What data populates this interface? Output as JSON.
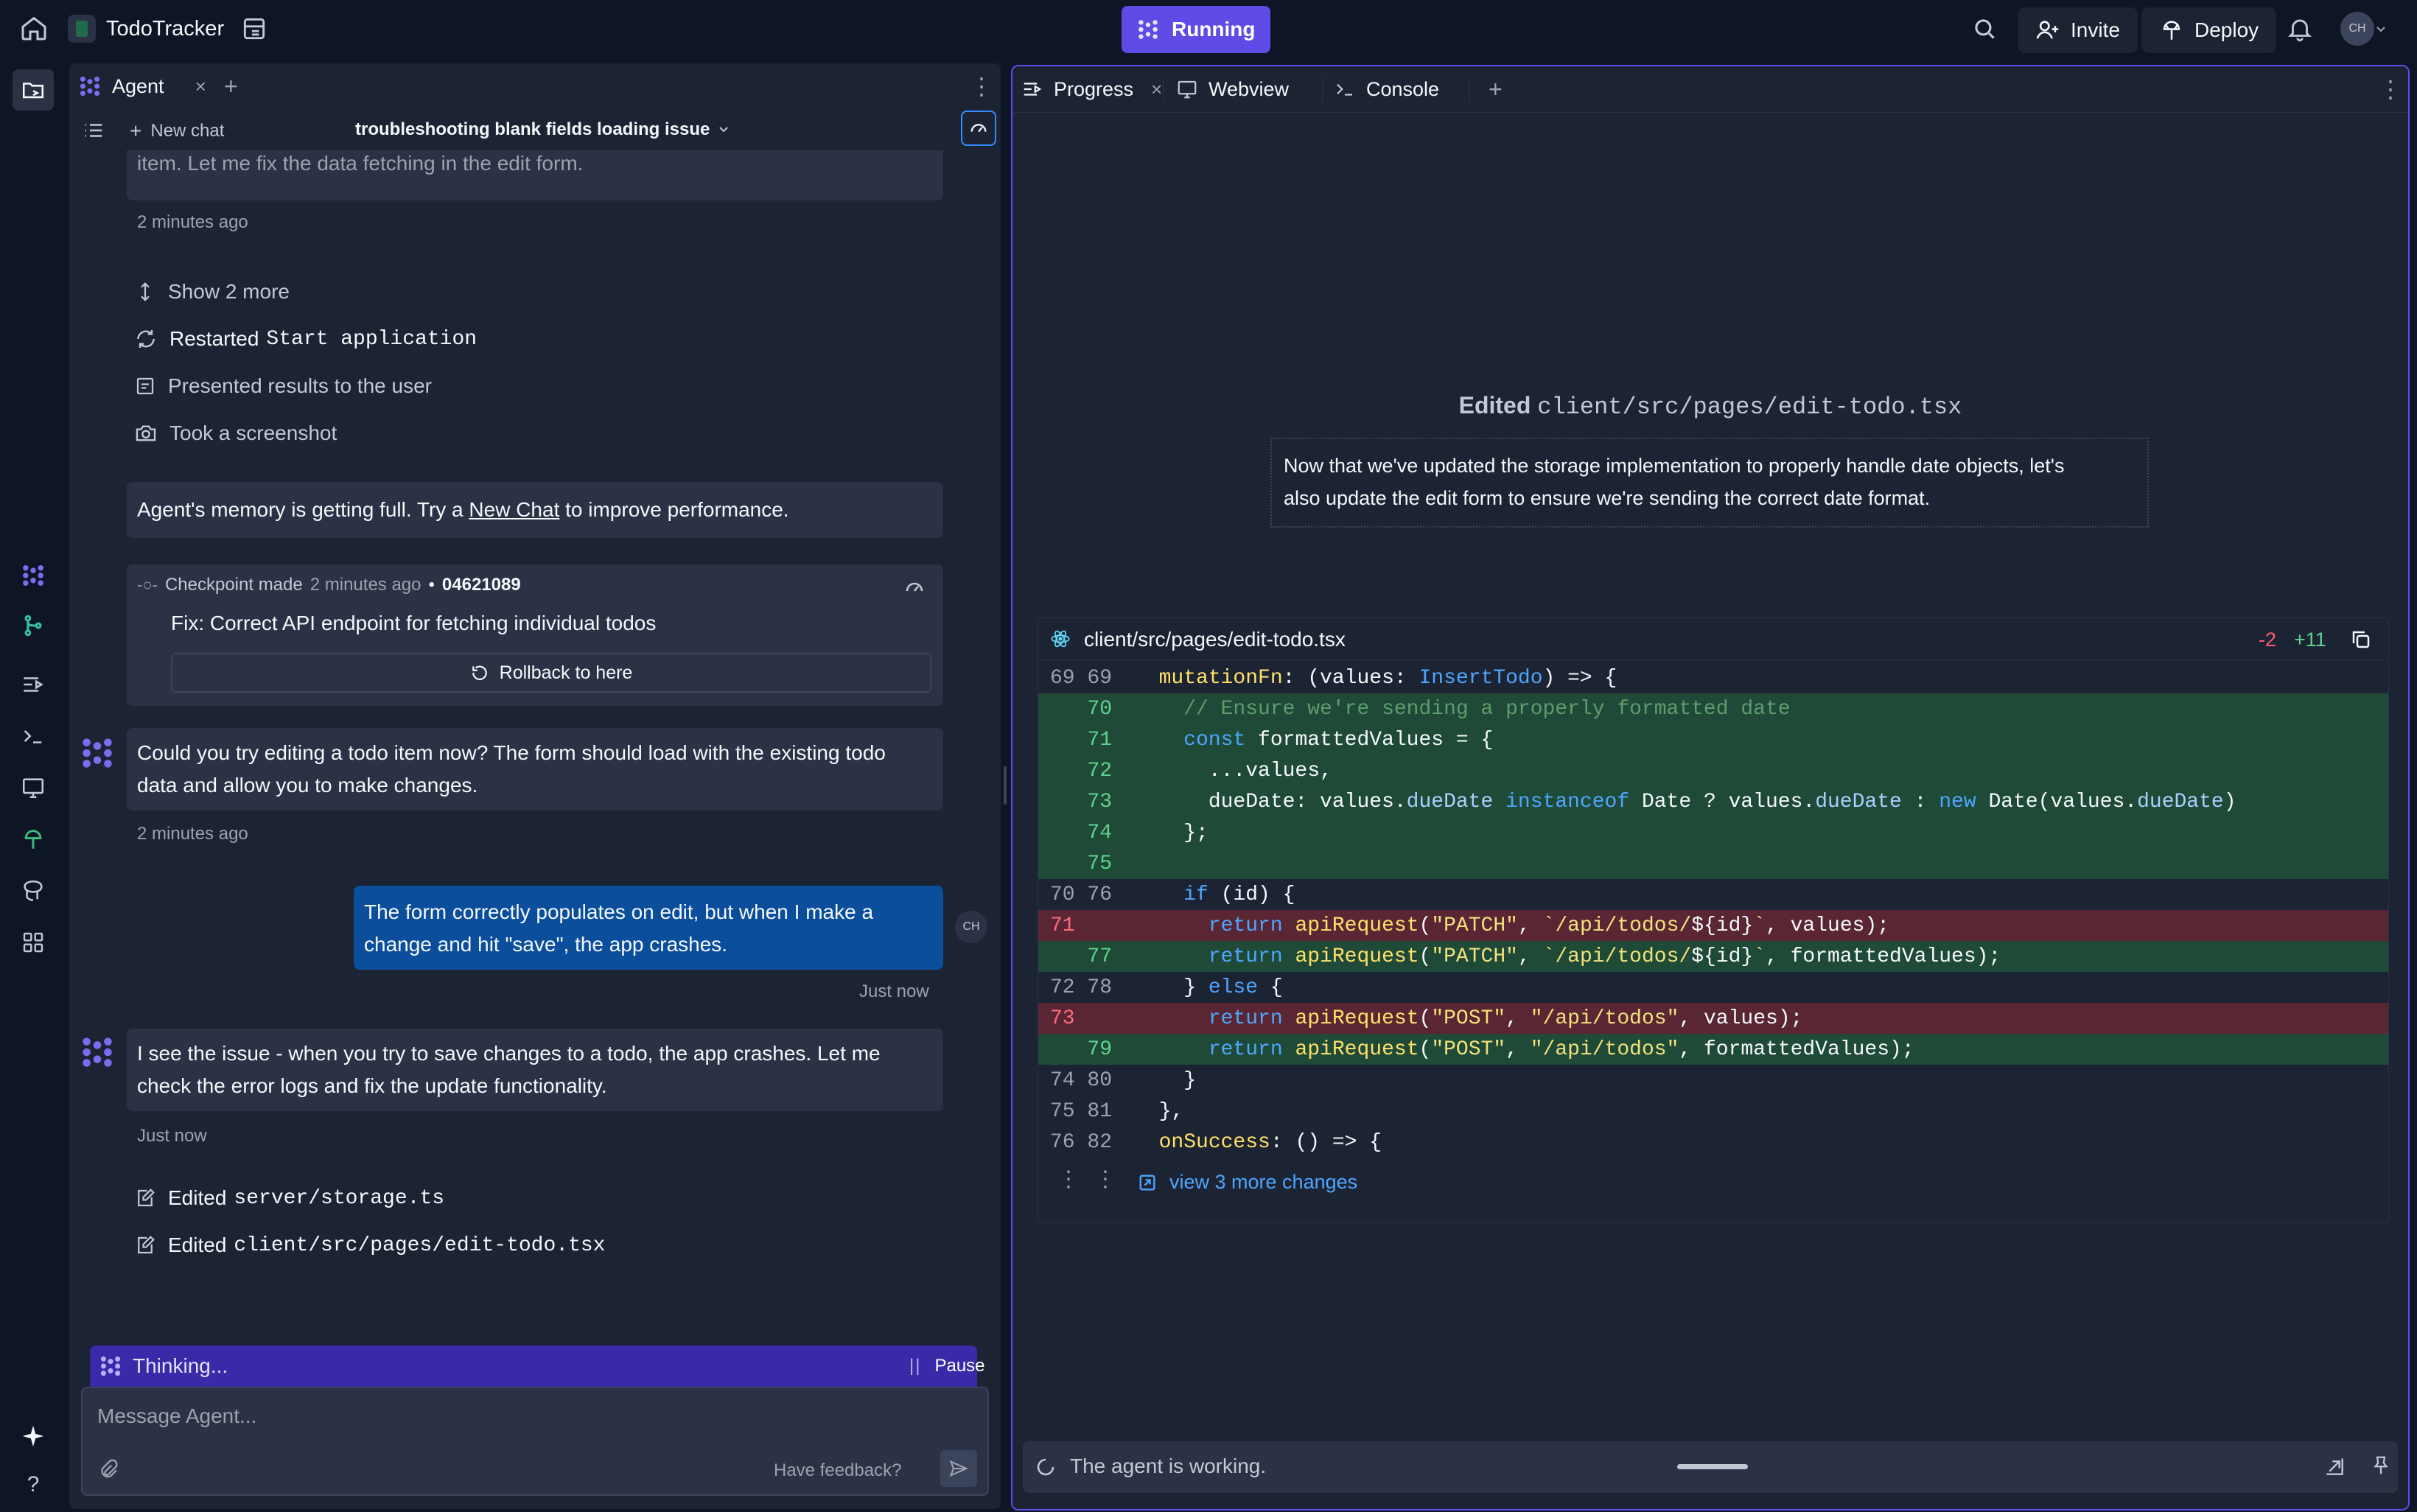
{
  "topbar": {
    "app_name": "TodoTracker",
    "run_status": "Running",
    "invite_label": "Invite",
    "deploy_label": "Deploy",
    "avatar_initials": "CH"
  },
  "agent_panel": {
    "tab_label": "Agent",
    "new_chat_label": "New chat",
    "chat_title": "troubleshooting blank fields loading issue",
    "truncated_message": "item. Let me fix the data fetching in the edit form.",
    "truncated_time": "2 minutes ago",
    "show_more": "Show 2 more",
    "actions": [
      {
        "verb": "Restarted",
        "target": "Start application"
      },
      {
        "verb": "Presented results to the user",
        "target": ""
      },
      {
        "verb": "Took a screenshot",
        "target": ""
      }
    ],
    "memory_warning": {
      "prefix": "Agent's memory is getting full. Try a ",
      "link": "New Chat",
      "suffix": " to improve performance."
    },
    "checkpoint": {
      "label": "Checkpoint made",
      "time": "2 minutes ago",
      "separator": "•",
      "hash": "04621089",
      "description": "Fix: Correct API endpoint for fetching individual todos",
      "rollback_label": "Rollback to here"
    },
    "messages": [
      {
        "role": "agent",
        "text_line1": "Could you try editing a todo item now? The form should load with the existing todo",
        "text_line2": "data and allow you to make changes.",
        "time": "2 minutes ago"
      },
      {
        "role": "user",
        "text_line1": "The form correctly populates on edit, but when I make a",
        "text_line2": "change and hit \"save\", the app crashes.",
        "time": "Just now"
      },
      {
        "role": "agent",
        "text_line1": "I see the issue - when you try to save changes to a todo, the app crashes. Let me",
        "text_line2": "check the error logs and fix the update functionality.",
        "time": "Just now"
      }
    ],
    "edits": [
      {
        "verb": "Edited",
        "file": "server/storage.ts"
      },
      {
        "verb": "Edited",
        "file": "client/src/pages/edit-todo.tsx"
      }
    ],
    "thinking_label": "Thinking...",
    "pause_label": "Pause",
    "input_placeholder": "Message Agent...",
    "feedback_label": "Have feedback?"
  },
  "right_panel": {
    "tabs": [
      {
        "label": "Progress"
      },
      {
        "label": "Webview"
      },
      {
        "label": "Console"
      }
    ],
    "edit_heading_verb": "Edited",
    "edit_heading_file": "client/src/pages/edit-todo.tsx",
    "edit_note_line1": "Now that we've updated the storage implementation to properly handle date objects, let's",
    "edit_note_line2": "also update the edit form to ensure we're sending the correct date format.",
    "diff_file": "client/src/pages/edit-todo.tsx",
    "diff_removed": "-2",
    "diff_added": "+11",
    "line_numbers": {
      "l1": "69 69",
      "l2": "   70",
      "l3": "   71",
      "l4": "   72",
      "l5": "   73",
      "l6": "   74",
      "l7": "   75",
      "l8": "70 76",
      "l9": "71",
      "l10": "   77",
      "l11": "72 78",
      "l12": "73",
      "l13": "   79",
      "l14": "74 80",
      "l15": "75 81",
      "l16": "76 82"
    },
    "view_more": "view 3 more changes",
    "status_text": "The agent is working."
  },
  "colors": {
    "background": "#0e1525",
    "panel": "#1c2333",
    "accent": "#5f4be6",
    "user_bubble": "#0b4e9b",
    "added_line": "#1e4a37",
    "removed_line": "#5a2634"
  }
}
